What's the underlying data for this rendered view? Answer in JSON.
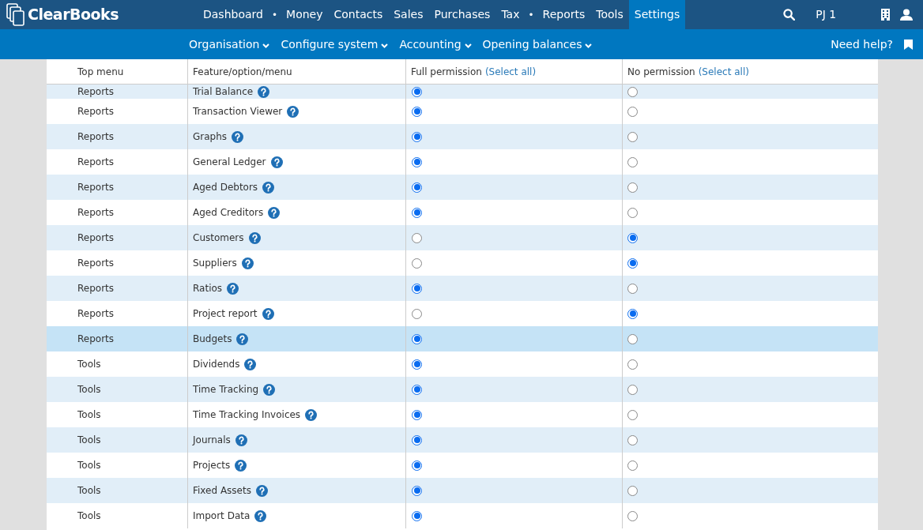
{
  "logo": {
    "text": "ClearBooks"
  },
  "nav": [
    {
      "kind": "item",
      "label": "Dashboard",
      "selected": false
    },
    {
      "kind": "separator",
      "label": "•"
    },
    {
      "kind": "item",
      "label": "Money",
      "selected": false
    },
    {
      "kind": "item",
      "label": "Contacts",
      "selected": false
    },
    {
      "kind": "item",
      "label": "Sales",
      "selected": false
    },
    {
      "kind": "item",
      "label": "Purchases",
      "selected": false
    },
    {
      "kind": "item",
      "label": "Tax",
      "selected": false
    },
    {
      "kind": "separator",
      "label": "•"
    },
    {
      "kind": "item",
      "label": "Reports",
      "selected": false
    },
    {
      "kind": "item",
      "label": "Tools",
      "selected": false
    },
    {
      "kind": "item",
      "label": "Settings",
      "selected": true
    }
  ],
  "user": "PJ 1",
  "subnav": [
    "Organisation",
    "Configure system",
    "Accounting",
    "Opening balances"
  ],
  "help": "Need help?",
  "table": {
    "columns": [
      {
        "label": "Top menu"
      },
      {
        "label": "Feature/option/menu"
      },
      {
        "label": "Full permission",
        "link": "(Select all)"
      },
      {
        "label": "No permission",
        "link": "(Select all)"
      }
    ],
    "rows": [
      {
        "menu": "Reports",
        "feature": "Trial Balance",
        "full": true,
        "highlighted": false
      },
      {
        "menu": "Reports",
        "feature": "Transaction Viewer",
        "full": true,
        "highlighted": false
      },
      {
        "menu": "Reports",
        "feature": "Graphs",
        "full": true,
        "highlighted": false
      },
      {
        "menu": "Reports",
        "feature": "General Ledger",
        "full": true,
        "highlighted": false
      },
      {
        "menu": "Reports",
        "feature": "Aged Debtors",
        "full": true,
        "highlighted": false
      },
      {
        "menu": "Reports",
        "feature": "Aged Creditors",
        "full": true,
        "highlighted": false
      },
      {
        "menu": "Reports",
        "feature": "Customers",
        "full": false,
        "highlighted": false
      },
      {
        "menu": "Reports",
        "feature": "Suppliers",
        "full": false,
        "highlighted": false
      },
      {
        "menu": "Reports",
        "feature": "Ratios",
        "full": true,
        "highlighted": false
      },
      {
        "menu": "Reports",
        "feature": "Project report",
        "full": false,
        "highlighted": false
      },
      {
        "menu": "Reports",
        "feature": "Budgets",
        "full": true,
        "highlighted": true
      },
      {
        "menu": "Tools",
        "feature": "Dividends",
        "full": true,
        "highlighted": false
      },
      {
        "menu": "Tools",
        "feature": "Time Tracking",
        "full": true,
        "highlighted": false
      },
      {
        "menu": "Tools",
        "feature": "Time Tracking Invoices",
        "full": true,
        "highlighted": false
      },
      {
        "menu": "Tools",
        "feature": "Journals",
        "full": true,
        "highlighted": false
      },
      {
        "menu": "Tools",
        "feature": "Projects",
        "full": true,
        "highlighted": false
      },
      {
        "menu": "Tools",
        "feature": "Fixed Assets",
        "full": true,
        "highlighted": false
      },
      {
        "menu": "Tools",
        "feature": "Import Data",
        "full": true,
        "highlighted": false
      }
    ]
  }
}
